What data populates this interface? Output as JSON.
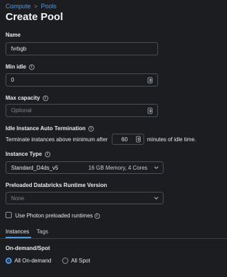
{
  "breadcrumb": {
    "items": [
      "Compute",
      "Pools"
    ]
  },
  "page_title": "Create Pool",
  "name": {
    "label": "Name",
    "value": "fvrbgb"
  },
  "min_idle": {
    "label": "Min idle",
    "value": "0"
  },
  "max_capacity": {
    "label": "Max capacity",
    "placeholder": "Optional"
  },
  "auto_termination": {
    "label": "Idle Instance Auto Termination",
    "prefix": "Terminate instances above minimum after",
    "minutes": "60",
    "suffix": "minutes of idle time."
  },
  "instance_type": {
    "label": "Instance Type",
    "value": "Standard_D4ds_v5",
    "spec": "16 GB Memory, 4 Cores"
  },
  "runtime": {
    "label": "Preloaded Databricks Runtime Version",
    "value": "None"
  },
  "photon": {
    "label": "Use Photon preloaded runtimes",
    "checked": false
  },
  "tabs": [
    {
      "label": "Instances",
      "active": true
    },
    {
      "label": "Tags",
      "active": false
    }
  ],
  "on_demand_spot": {
    "label": "On-demand/Spot",
    "options": [
      {
        "label": "All On-demand",
        "selected": true
      },
      {
        "label": "All Spot",
        "selected": false
      }
    ]
  },
  "colors": {
    "accent": "#4c9be8",
    "background": "#1b1d21",
    "border": "#4a4f57"
  },
  "icons": [
    "info-icon",
    "chevron-down-icon",
    "stepper-icon"
  ]
}
